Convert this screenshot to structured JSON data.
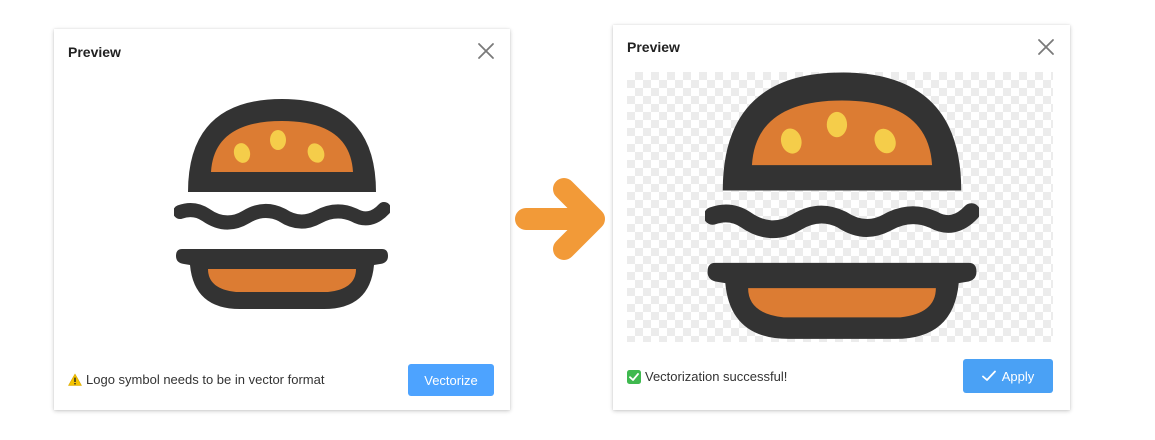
{
  "left_dialog": {
    "title": "Preview",
    "status_text": "Logo symbol needs to be in vector format",
    "status_icon": "warning-icon",
    "button_label": "Vectorize"
  },
  "right_dialog": {
    "title": "Preview",
    "status_text": "Vectorization successful!",
    "status_icon": "check-mark-icon",
    "button_label": "Apply"
  },
  "colors": {
    "accent_button": "#4da3ff",
    "arrow": "#f29a38",
    "burger_outline": "#333333",
    "bun_fill": "#dc7c33",
    "seeds": "#f5cd4a"
  }
}
